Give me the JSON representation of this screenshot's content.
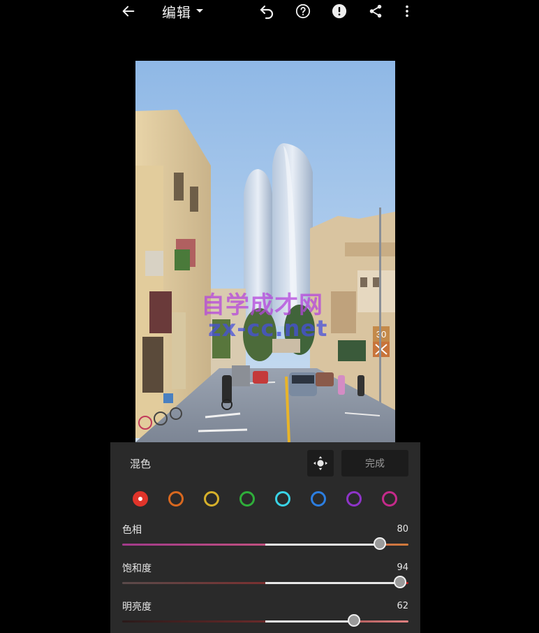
{
  "topbar": {
    "title": "编辑",
    "icons": [
      "back-arrow-icon",
      "chevron-down-icon",
      "undo-icon",
      "help-icon",
      "alert-icon",
      "share-icon",
      "more-vert-icon"
    ]
  },
  "photo": {
    "watermark_line1": "自学成才网",
    "watermark_line2": "zx-cc.net",
    "sign_number": "30"
  },
  "panel": {
    "title": "混色",
    "done_label": "完成",
    "color_swatches": [
      {
        "name": "red",
        "color": "#e0342a",
        "selected": true
      },
      {
        "name": "orange",
        "color": "#d8681f"
      },
      {
        "name": "yellow",
        "color": "#d6b02a"
      },
      {
        "name": "green",
        "color": "#2fae3a"
      },
      {
        "name": "aqua",
        "color": "#39d3e6"
      },
      {
        "name": "blue",
        "color": "#2c7ee0"
      },
      {
        "name": "purple",
        "color": "#8e34c8"
      },
      {
        "name": "magenta",
        "color": "#c42a8a"
      }
    ],
    "sliders": [
      {
        "label": "色相",
        "value": "80",
        "fraction": 0.9
      },
      {
        "label": "饱和度",
        "value": "94",
        "fraction": 0.97
      },
      {
        "label": "明亮度",
        "value": "62",
        "fraction": 0.81
      }
    ]
  }
}
